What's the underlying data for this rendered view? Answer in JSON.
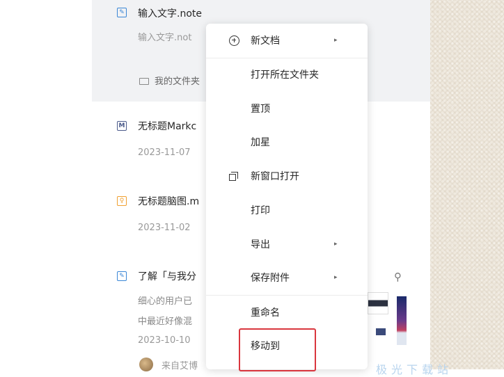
{
  "files": [
    {
      "icon": "note-icon",
      "title": "输入文字.note",
      "preview": "输入文字.not",
      "folder": "我的文件夹"
    },
    {
      "icon": "markdown-icon",
      "title": "无标题Markc",
      "date": "2023-11-07"
    },
    {
      "icon": "mindmap-icon",
      "title": "无标题脑图.m",
      "date": "2023-11-02"
    },
    {
      "icon": "note-icon",
      "title": "了解「与我分",
      "line1": "细心的用户已",
      "line2": "中最近好像混",
      "date": "2023-10-10",
      "source": "来自艾博"
    }
  ],
  "icon_glyphs": {
    "markdown": "M",
    "mindmap": "♀",
    "share": "⚲"
  },
  "context_menu": {
    "items": [
      {
        "label": "新文档",
        "icon": "plus-circle-icon",
        "submenu": true
      },
      {
        "label": "打开所在文件夹"
      },
      {
        "label": "置顶"
      },
      {
        "label": "加星"
      },
      {
        "label": "新窗口打开",
        "icon": "new-window-icon"
      },
      {
        "label": "打印"
      },
      {
        "label": "导出",
        "submenu": true
      },
      {
        "label": "保存附件",
        "submenu": true
      },
      {
        "label": "重命名"
      },
      {
        "label": "移动到"
      }
    ],
    "submenu_arrow": "▸"
  },
  "watermark": "极光下载站",
  "colors": {
    "highlight": "#d9363e",
    "note_icon": "#3a86d6",
    "mindmap_icon": "#f0a030",
    "selected_row": "#f1f2f4"
  }
}
